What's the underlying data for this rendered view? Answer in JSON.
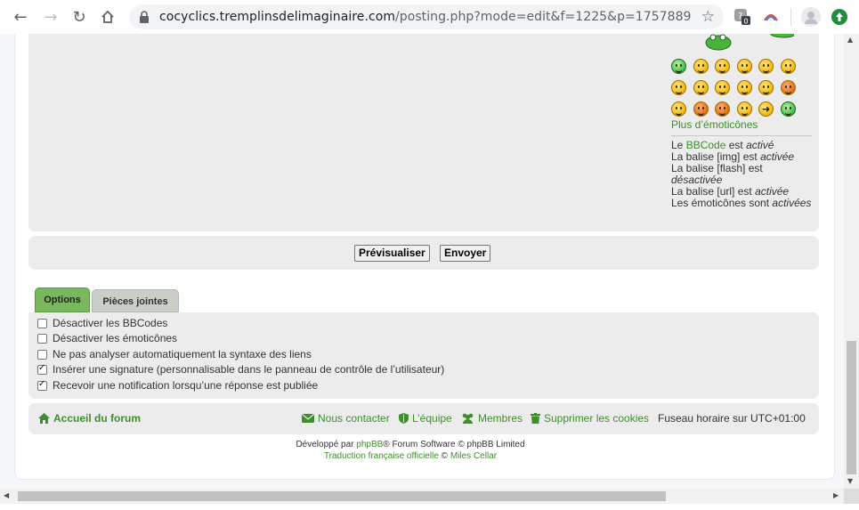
{
  "browser": {
    "url_host": "cocyclics.tremplinsdelimaginaire.com",
    "url_path": "/posting.php?mode=edit&f=1225&p=1757889",
    "extension_badge": "0"
  },
  "editor": {
    "more_smilies": "Plus d’émoticônes",
    "bbinfo": {
      "line1_prefix": "Le ",
      "line1_link": "BBCode",
      "line1_mid": " est ",
      "line1_state": "activé",
      "line2_prefix": "La balise [img] est ",
      "line2_state": "activée",
      "line3_prefix": "La balise [flash] est ",
      "line3_state": "désactivée",
      "line4_prefix": "La balise [url] est ",
      "line4_state": "activée",
      "line5_prefix": "Les émoticônes sont ",
      "line5_state": "activées"
    }
  },
  "actions": {
    "preview": "Prévisualiser",
    "submit": "Envoyer"
  },
  "tabs": {
    "options": "Options",
    "attachments": "Pièces jointes"
  },
  "options": [
    {
      "label": "Désactiver les BBCodes",
      "checked": false
    },
    {
      "label": "Désactiver les émoticônes",
      "checked": false
    },
    {
      "label": "Ne pas analyser automatiquement la syntaxe des liens",
      "checked": false
    },
    {
      "label": "Insérer une signature (personnalisable dans le panneau de contrôle de l’utilisateur)",
      "checked": true
    },
    {
      "label": "Recevoir une notification lorsqu’une réponse est publiée",
      "checked": true
    }
  ],
  "footer": {
    "home": "Accueil du forum",
    "contact": "Nous contacter",
    "team": "L’équipe",
    "members": "Membres",
    "cookies": "Supprimer les cookies",
    "timezone": "Fuseau horaire sur UTC+01:00"
  },
  "credits": {
    "line1_a": "Développé par ",
    "line1_link": "phpBB",
    "line1_b": "® Forum Software © phpBB Limited",
    "line2_a": "Traduction française officielle",
    "line2_b": " © ",
    "line2_c": "Miles Cellar"
  },
  "colors": {
    "accent": "#3e8e2b",
    "panel": "#ececec",
    "tab_active": "#7ab85f"
  }
}
